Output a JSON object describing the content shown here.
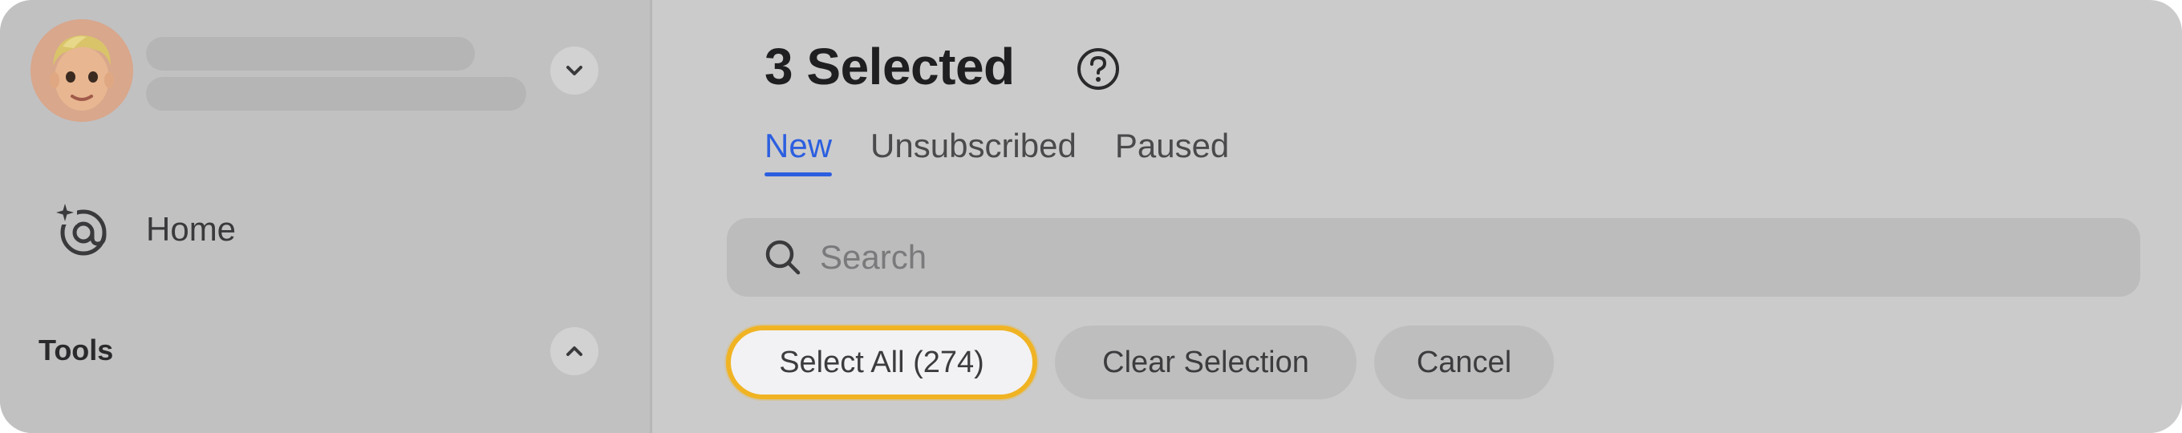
{
  "sidebar": {
    "home_label": "Home",
    "tools_label": "Tools",
    "icons": {
      "account_toggle": "chevron-down-icon",
      "home": "at-sparkle-icon",
      "tools_toggle": "chevron-up-icon"
    }
  },
  "main": {
    "title": "3 Selected",
    "tabs": [
      {
        "label": "New",
        "active": true
      },
      {
        "label": "Unsubscribed",
        "active": false
      },
      {
        "label": "Paused",
        "active": false
      }
    ],
    "search": {
      "placeholder": "Search",
      "value": ""
    },
    "actions": {
      "select_all": "Select All (274)",
      "clear_selection": "Clear Selection",
      "cancel": "Cancel"
    }
  },
  "colors": {
    "accent": "#2c5fe0",
    "highlight": "#f0b323",
    "sidebar_bg": "#c1c1c2",
    "main_bg": "#cbcbcb"
  }
}
